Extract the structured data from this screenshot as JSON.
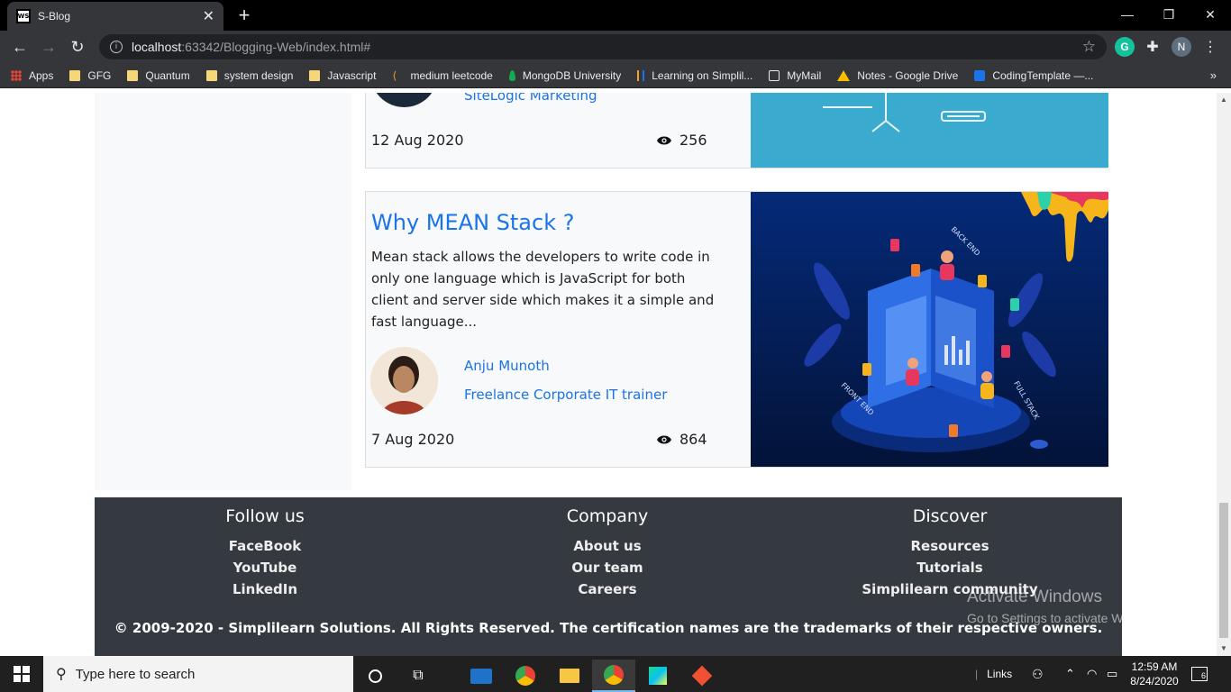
{
  "browser": {
    "tab_title": "S-Blog",
    "tab_favicon": "WS",
    "url_host": "localhost",
    "url_path": ":63342/Blogging-Web/index.html#",
    "profile_initial": "N",
    "bookmarks": [
      "Apps",
      "GFG",
      "Quantum",
      "system design",
      "Javascript",
      "medium leetcode",
      "MongoDB University",
      "Learning on Simplil...",
      "MyMail",
      "Notes - Google Drive",
      "CodingTemplate —..."
    ]
  },
  "posts": [
    {
      "author_role": "SiteLogic Marketing",
      "date": "12 Aug 2020",
      "views": "256"
    },
    {
      "title": "Why MEAN Stack ?",
      "excerpt": "Mean stack allows the developers to write code in only one language which is JavaScript for both client and server side which makes it a simple and fast language...",
      "author_name": "Anju Munoth",
      "author_role": "Freelance Corporate IT trainer",
      "date": "7 Aug 2020",
      "views": "864",
      "image_labels": [
        "BACK END",
        "FRONT END",
        "FULL STACK"
      ]
    }
  ],
  "footer": {
    "columns": [
      {
        "heading": "Follow us",
        "links": [
          "FaceBook",
          "YouTube",
          "LinkedIn"
        ]
      },
      {
        "heading": "Company",
        "links": [
          "About us",
          "Our team",
          "Careers"
        ]
      },
      {
        "heading": "Discover",
        "links": [
          "Resources",
          "Tutorials",
          "Simplilearn community"
        ]
      }
    ],
    "copyright": "© 2009-2020 - Simplilearn Solutions. All Rights Reserved. The certification names are the trademarks of their respective owners."
  },
  "watermark": {
    "line1": "Activate Windows",
    "line2": "Go to Settings to activate Windows."
  },
  "taskbar": {
    "search_placeholder": "Type here to search",
    "links_label": "Links",
    "time": "12:59 AM",
    "date": "8/24/2020",
    "notification_count": "6"
  },
  "colors": {
    "link_blue": "#1a73e8",
    "footer_bg": "#343a40",
    "card_bg": "#f8f9fa"
  }
}
